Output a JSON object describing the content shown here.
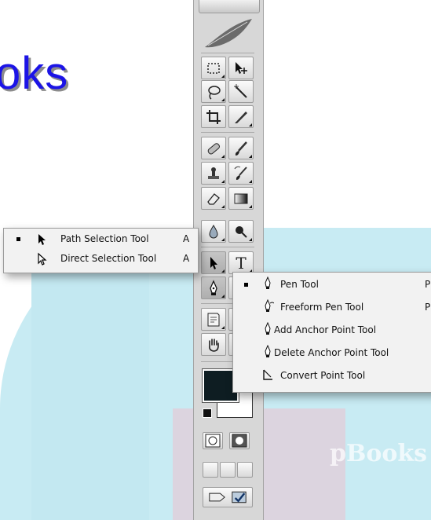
{
  "slide": {
    "title": "oks",
    "watermark": "pBooks"
  },
  "path_flyout": {
    "items": [
      {
        "label": "Path Selection Tool",
        "shortcut": "A",
        "selected": true
      },
      {
        "label": "Direct Selection Tool",
        "shortcut": "A",
        "selected": false
      }
    ]
  },
  "pen_flyout": {
    "items": [
      {
        "label": "Pen Tool",
        "shortcut": "P",
        "selected": true
      },
      {
        "label": "Freeform Pen Tool",
        "shortcut": "P",
        "selected": false
      },
      {
        "label": "Add Anchor Point Tool",
        "shortcut": "",
        "selected": false
      },
      {
        "label": "Delete Anchor Point Tool",
        "shortcut": "",
        "selected": false
      },
      {
        "label": "Convert Point Tool",
        "shortcut": "",
        "selected": false
      }
    ]
  },
  "toolbox": {
    "tools": [
      "rectangular-marquee",
      "move",
      "lasso",
      "magic-wand",
      "crop",
      "slice",
      "healing-brush",
      "brush",
      "clone-stamp",
      "history-brush",
      "eraser",
      "gradient",
      "blur",
      "dodge",
      "path-selection",
      "type",
      "pen",
      "custom-shape",
      "notes",
      "eyedropper",
      "hand",
      "zoom"
    ],
    "foreground_color": "#0e1d22",
    "background_color": "#ffffff"
  },
  "colors": {
    "title": "#1c14e6",
    "panel_bg": "#c8ebf3",
    "toolbox": "#d7d7d7",
    "menu_bg": "#f2f2f2"
  }
}
